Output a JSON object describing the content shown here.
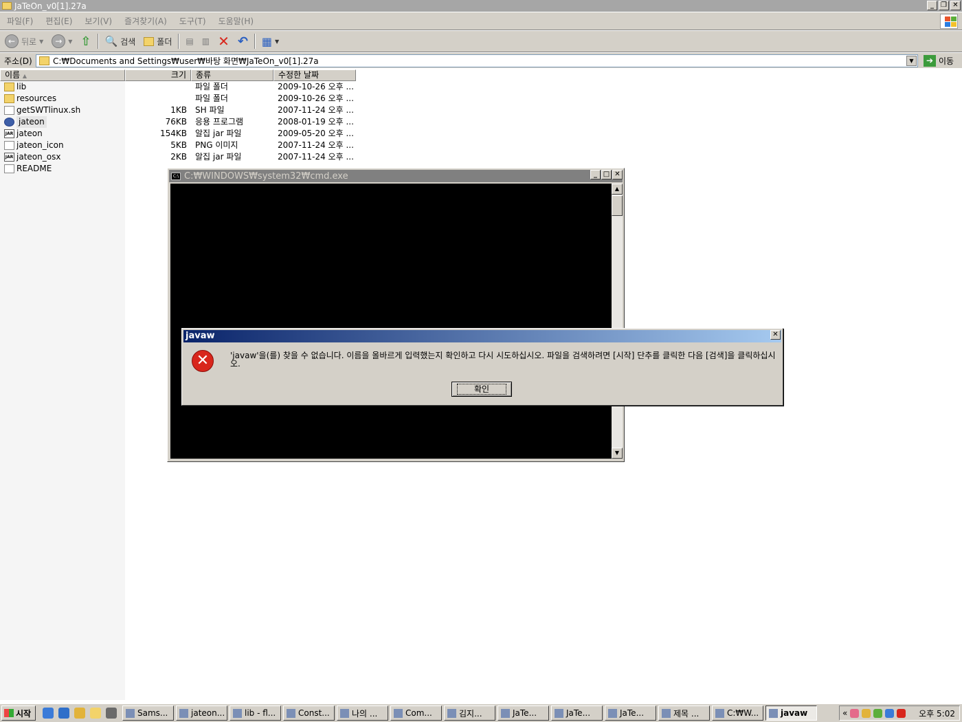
{
  "explorer": {
    "title": "JaTeOn_v0[1].27a",
    "menu": [
      "파일(F)",
      "편집(E)",
      "보기(V)",
      "즐겨찾기(A)",
      "도구(T)",
      "도움말(H)"
    ],
    "toolbar": {
      "back": "뒤로",
      "search": "검색",
      "folders": "폴더"
    },
    "address": {
      "label": "주소(D)",
      "path": "C:₩Documents and Settings₩user₩바탕 화면₩JaTeOn_v0[1].27a",
      "go": "이동"
    },
    "columns": {
      "name": "이름",
      "size": "크기",
      "type": "종류",
      "modified": "수정한 날짜"
    },
    "files": [
      {
        "name": "lib",
        "size": "",
        "type": "파일 폴더",
        "date": "2009-10-26 오후 ...",
        "icon": "folder"
      },
      {
        "name": "resources",
        "size": "",
        "type": "파일 폴더",
        "date": "2009-10-26 오후 ...",
        "icon": "folder"
      },
      {
        "name": "getSWTlinux.sh",
        "size": "1KB",
        "type": "SH 파일",
        "date": "2007-11-24 오후 ...",
        "icon": "doc"
      },
      {
        "name": "jateon",
        "size": "76KB",
        "type": "응용 프로그램",
        "date": "2008-01-19 오후 ...",
        "icon": "app"
      },
      {
        "name": "jateon",
        "size": "154KB",
        "type": "알집 jar 파일",
        "date": "2009-05-20 오후 ...",
        "icon": "jar"
      },
      {
        "name": "jateon_icon",
        "size": "5KB",
        "type": "PNG 이미지",
        "date": "2007-11-24 오후 ...",
        "icon": "doc"
      },
      {
        "name": "jateon_osx",
        "size": "2KB",
        "type": "알집 jar 파일",
        "date": "2007-11-24 오후 ...",
        "icon": "jar"
      },
      {
        "name": "README",
        "size": "",
        "type": "",
        "date": "",
        "icon": "doc"
      }
    ]
  },
  "cmd": {
    "title": "C:₩WINDOWS₩system32₩cmd.exe"
  },
  "dialog": {
    "title": "javaw",
    "message": "'javaw'을(를) 찾을 수 없습니다. 이름을 올바르게 입력했는지 확인하고 다시 시도하십시오. 파일을 검색하려면 [시작] 단추를 클릭한 다음 [검색]을 클릭하십시오.",
    "ok": "확인"
  },
  "taskbar": {
    "start": "시작",
    "tasks": [
      "Sams...",
      "jateon...",
      "lib - fl...",
      "Const...",
      "나의 ...",
      "Com...",
      "김지...",
      "JaTe...",
      "JaTe...",
      "JaTe...",
      "제목 ...",
      "C:₩W...",
      "javaw"
    ],
    "clock": "오후 5:02"
  },
  "colors": {
    "titlebar_inactive": "#a6a6a6",
    "dialog_title": "#0a246a",
    "error_red": "#d8261c",
    "face": "#d4d0c8"
  }
}
